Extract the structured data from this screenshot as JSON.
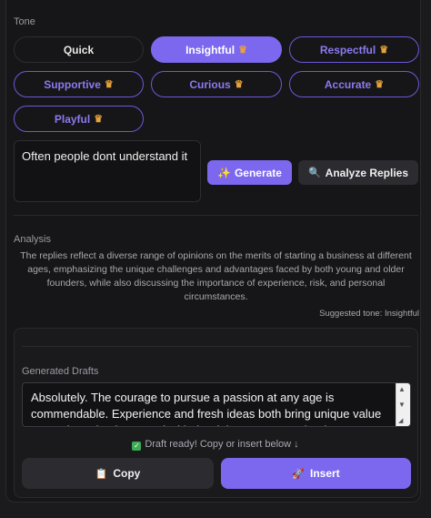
{
  "tone": {
    "label": "Tone",
    "options": [
      {
        "label": "Quick"
      },
      {
        "label": "Insightful"
      },
      {
        "label": "Respectful"
      },
      {
        "label": "Supportive"
      },
      {
        "label": "Curious"
      },
      {
        "label": "Accurate"
      },
      {
        "label": "Playful"
      }
    ],
    "selected": "Insightful",
    "premium_icon": "crown-icon"
  },
  "input": {
    "value": "Often people dont understand it"
  },
  "actions": {
    "generate_label": "Generate",
    "generate_icon": "✨",
    "analyze_label": "Analyze Replies",
    "analyze_icon": "🔍"
  },
  "analysis": {
    "label": "Analysis",
    "text": "The replies reflect a diverse range of opinions on the merits of starting a business at different ages, emphasizing the unique challenges and advantages faced by both young and older founders, while also discussing the importance of experience, risk, and personal circumstances.",
    "suggested_tone": "Suggested tone: Insightful"
  },
  "drafts": {
    "label": "Generated Drafts",
    "text": "Absolutely. The courage to pursue a passion at any age is commendable. Experience and fresh ideas both bring unique value to starting a business and with the right support can lead to success.",
    "status": "Draft ready! Copy or insert below ↓",
    "status_icon": "✓",
    "copy_label": "Copy",
    "copy_icon": "📋",
    "insert_label": "Insert",
    "insert_icon": "🚀"
  },
  "colors": {
    "accent": "#7b68ee",
    "background": "#161618"
  }
}
